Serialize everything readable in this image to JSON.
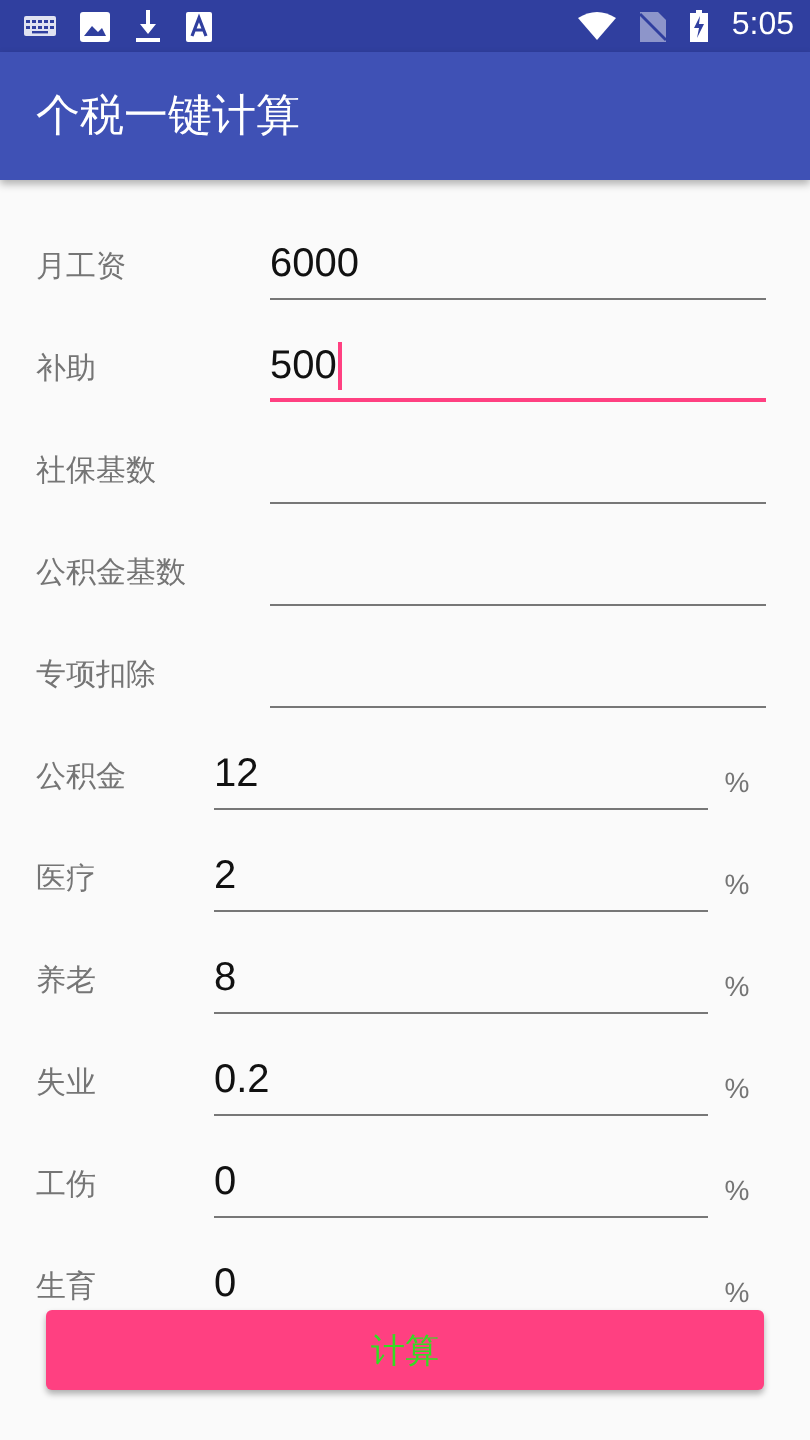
{
  "status_bar": {
    "time": "5:05"
  },
  "app_bar": {
    "title": "个税一键计算"
  },
  "fields": [
    {
      "label": "月工资",
      "value": "6000",
      "focused": false,
      "kind": "plain"
    },
    {
      "label": "补助",
      "value": "500",
      "focused": true,
      "kind": "plain"
    },
    {
      "label": "社保基数",
      "focused": false,
      "kind": "plain"
    },
    {
      "label": "公积金基数",
      "focused": false,
      "kind": "plain"
    },
    {
      "label": "专项扣除",
      "focused": false,
      "kind": "plain"
    },
    {
      "label": "公积金",
      "value": "12",
      "focused": false,
      "kind": "percent",
      "unit": "%"
    },
    {
      "label": "医疗",
      "value": "2",
      "focused": false,
      "kind": "percent",
      "unit": "%"
    },
    {
      "label": "养老",
      "value": "8",
      "focused": false,
      "kind": "percent",
      "unit": "%"
    },
    {
      "label": "失业",
      "value": "0.2",
      "focused": false,
      "kind": "percent",
      "unit": "%"
    },
    {
      "label": "工伤",
      "value": "0",
      "focused": false,
      "kind": "percent",
      "unit": "%"
    },
    {
      "label": "生育",
      "value": "0",
      "focused": false,
      "kind": "percent",
      "unit": "%"
    }
  ],
  "calculate_button": {
    "label": "计算"
  }
}
